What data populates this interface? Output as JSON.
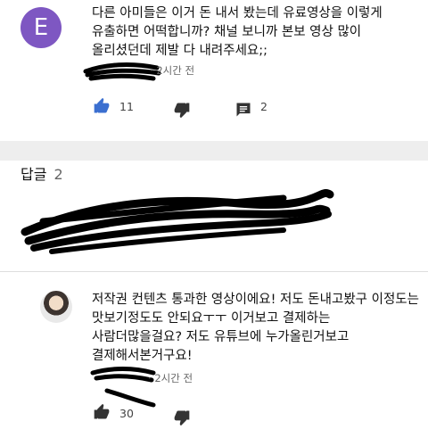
{
  "comment": {
    "avatar_letter": "E",
    "avatar_color": "#7e57c2",
    "text": "다른 아미들은 이거 돈 내서 봤는데 유료영상을 이렇게\n유출하면 어떡합니까? 채널 보니까 본보 영상 많이\n올리셨던데 제발 다 내려주세요;;",
    "time": "2시간 전",
    "likes": "11",
    "replies": "2"
  },
  "replies_section": {
    "label": "답글",
    "count": "2"
  },
  "reply": {
    "text": "저작권 컨텐츠 통과한 영상이에요! 저도 돈내고봤구 이정도는\n맛보기정도도 안되요ㅜㅜ 이거보고 결제하는\n사람더많을걸요? 저도 유튜브에 누가올린거보고\n결제해서본거구요!",
    "time": "2시간 전",
    "likes": "30"
  },
  "colors": {
    "accent_blue": "#3b6fd0",
    "icon_dark": "#333333",
    "band": "#eeeeee"
  }
}
